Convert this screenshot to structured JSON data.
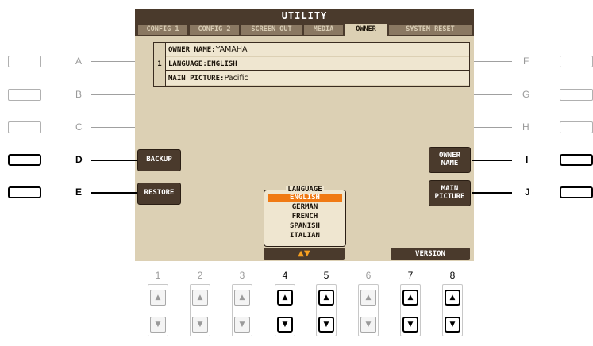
{
  "screen": {
    "title": "UTILITY",
    "tabs": [
      {
        "label": "CONFIG 1",
        "active": false
      },
      {
        "label": "CONFIG 2",
        "active": false
      },
      {
        "label": "SCREEN OUT",
        "active": false
      },
      {
        "label": "MEDIA",
        "active": false
      },
      {
        "label": "OWNER",
        "active": true
      },
      {
        "label": "SYSTEM RESET",
        "active": false
      }
    ],
    "info": {
      "index": "1",
      "owner_name_label": "OWNER NAME:",
      "owner_name_value": "YAMAHA",
      "language_label": "LANGUAGE:",
      "language_value": "ENGLISH",
      "main_picture_label": "MAIN PICTURE:",
      "main_picture_value": "Pacific"
    },
    "buttons": {
      "backup": "BACKUP",
      "restore": "RESTORE",
      "owner_name_1": "OWNER",
      "owner_name_2": "NAME",
      "main_picture_1": "MAIN",
      "main_picture_2": "PICTURE",
      "updown": "▲▼",
      "version": "VERSION"
    },
    "language_box": {
      "title": "LANGUAGE",
      "options": [
        "ENGLISH",
        "GERMAN",
        "FRENCH",
        "SPANISH",
        "ITALIAN"
      ],
      "selected": "ENGLISH"
    }
  },
  "side_buttons": {
    "left": [
      {
        "letter": "A",
        "active": false
      },
      {
        "letter": "B",
        "active": false
      },
      {
        "letter": "C",
        "active": false
      },
      {
        "letter": "D",
        "active": true
      },
      {
        "letter": "E",
        "active": true
      }
    ],
    "right": [
      {
        "letter": "F",
        "active": false
      },
      {
        "letter": "G",
        "active": false
      },
      {
        "letter": "H",
        "active": false
      },
      {
        "letter": "I",
        "active": true
      },
      {
        "letter": "J",
        "active": true
      }
    ]
  },
  "bottom_buttons": [
    {
      "number": "1",
      "active": false
    },
    {
      "number": "2",
      "active": false
    },
    {
      "number": "3",
      "active": false
    },
    {
      "number": "4",
      "active": true
    },
    {
      "number": "5",
      "active": true
    },
    {
      "number": "6",
      "active": false
    },
    {
      "number": "7",
      "active": true
    },
    {
      "number": "8",
      "active": true
    }
  ],
  "icons": {
    "up": "▲",
    "down": "▼"
  },
  "colors": {
    "screen_bg": "#dcd0b4",
    "header_bg": "#4a3a2c",
    "selection": "#f07a14",
    "arrow": "#f7a020"
  }
}
